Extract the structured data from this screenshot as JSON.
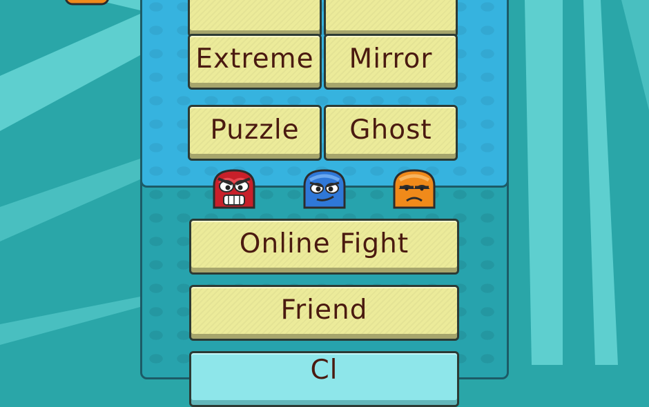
{
  "menu": {
    "top_buttons": [
      "",
      ""
    ],
    "mode_buttons": [
      {
        "label": "Extreme"
      },
      {
        "label": "Mirror"
      },
      {
        "label": "Puzzle"
      },
      {
        "label": "Ghost"
      }
    ],
    "online_fight_label": "Online Fight",
    "friend_label": "Friend",
    "bottom_button_label": "Cl"
  },
  "characters": [
    {
      "name": "red-angry-blob-icon",
      "color": "#c8202a"
    },
    {
      "name": "blue-smirk-blob-icon",
      "color": "#2f78d8"
    },
    {
      "name": "orange-grumpy-blob-icon",
      "color": "#f08a1a"
    }
  ],
  "colors": {
    "background": "#2aa6a8",
    "top_panel": "#36b3df",
    "button": "#eceb9a",
    "button_text": "#4a1a10",
    "border": "#1c5b67"
  }
}
